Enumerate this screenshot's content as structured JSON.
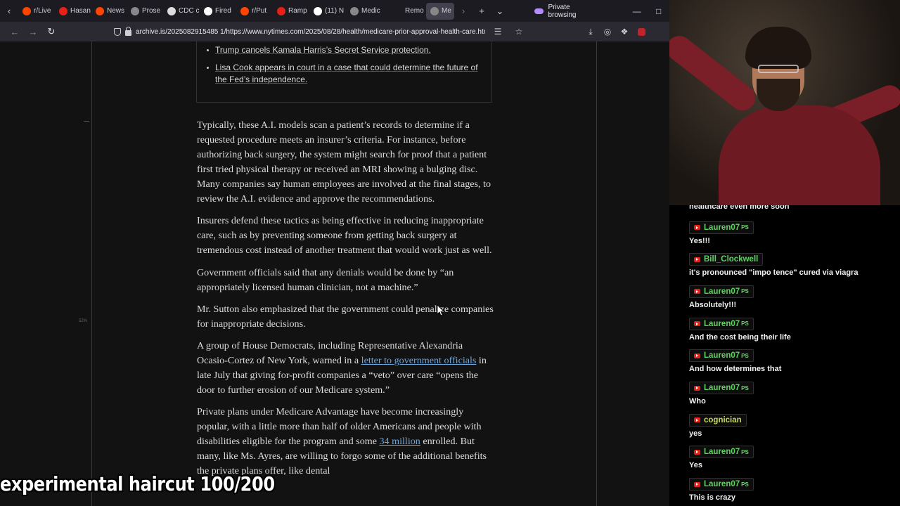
{
  "tabs": [
    {
      "label": "r/Live",
      "icon": "reddit-icon",
      "color": "#ff4500"
    },
    {
      "label": "Hasan",
      "icon": "youtube-icon",
      "color": "#e62117"
    },
    {
      "label": "News",
      "icon": "reddit-icon",
      "color": "#ff4500"
    },
    {
      "label": "Prose",
      "icon": "generic-page-icon",
      "color": "#888888"
    },
    {
      "label": "CDC c",
      "icon": "github-icon",
      "color": "#dddddd"
    },
    {
      "label": "Fired",
      "icon": "news-icon",
      "color": "#ffffff"
    },
    {
      "label": "r/Put",
      "icon": "reddit-icon",
      "color": "#ff4500"
    },
    {
      "label": "Ramp",
      "icon": "youtube-icon",
      "color": "#e62117"
    },
    {
      "label": "(11) N",
      "icon": "x-icon",
      "color": "#ffffff"
    },
    {
      "label": "Medic",
      "icon": "generic-page-icon",
      "color": "#888888"
    },
    {
      "label": "Remo",
      "icon": "blank-icon",
      "color": "#1c1b22"
    },
    {
      "label": "Me",
      "icon": "generic-page-icon",
      "color": "#888888",
      "active": true
    }
  ],
  "private_label": "Private browsing",
  "url": "archive.is/2025082915485 1/https://www.nytimes.com/2025/08/28/health/medicare-prior-approval-health-care.html",
  "zoom_marker": "52%",
  "bullets": [
    "Trump cancels Kamala Harris’s Secret Service protection.",
    "Lisa Cook appears in court in a case that could determine the future of the Fed’s independence."
  ],
  "article": {
    "p1": "Typically, these A.I. models scan a patient’s records to determine if a requested procedure meets an insurer’s criteria. For instance, before authorizing back surgery, the system might search for proof that a patient first tried physical therapy or received an MRI showing a bulging disc. Many companies say human employees are involved at the final stages, to review the A.I. evidence and approve the recommendations.",
    "p2": "Insurers defend these tactics as being effective in reducing inappropriate care, such as by preventing someone from getting back surgery at tremendous cost instead of another treatment that would work just as well.",
    "p3": "Government officials said that any denials would be done by “an appropriately licensed human clinician, not a machine.”",
    "p4": "Mr. Sutton also emphasized that the government could penalize companies for inappropriate decisions.",
    "p5_a": "A group of House Democrats, including Representative Alexandria Ocasio-Cortez of New York, warned in a ",
    "p5_link": "letter to government officials",
    "p5_b": " in late July that giving for-profit companies a “veto” over care “opens the door to further erosion of our Medicare system.”",
    "p6_a": "Private plans under Medicare Advantage have become increasingly popular, with a little more than half of older Americans and people with disabilities eligible for the program and some ",
    "p6_link": "34 million",
    "p6_b": " enrolled. But many, like Ms. Ayres, are willing to forgo some of the additional benefits the private plans offer, like dental"
  },
  "chat": {
    "partial_top": "healthcare even more soon",
    "messages": [
      {
        "user": "Lauren07",
        "badge": "PS",
        "color": "#5fd35f",
        "text": "Yes!!!"
      },
      {
        "user": "Bill_Clockwell",
        "badge": "",
        "color": "#5fd35f",
        "text": "it's pronounced \"impo tence\" cured via viagra"
      },
      {
        "user": "Lauren07",
        "badge": "PS",
        "color": "#5fd35f",
        "text": "Absolutely!!!"
      },
      {
        "user": "Lauren07",
        "badge": "PS",
        "color": "#5fd35f",
        "text": "And the cost being their life"
      },
      {
        "user": "Lauren07",
        "badge": "PS",
        "color": "#5fd35f",
        "text": "And how determines that"
      },
      {
        "user": "Lauren07",
        "badge": "PS",
        "color": "#5fd35f",
        "text": "Who"
      },
      {
        "user": "cognician",
        "badge": "",
        "color": "#c8d85a",
        "text": "yes"
      },
      {
        "user": "Lauren07",
        "badge": "PS",
        "color": "#5fd35f",
        "text": "Yes"
      },
      {
        "user": "Lauren07",
        "badge": "PS",
        "color": "#5fd35f",
        "text": "This is crazy"
      }
    ]
  },
  "overlay_text": "experimental haircut 100/200"
}
